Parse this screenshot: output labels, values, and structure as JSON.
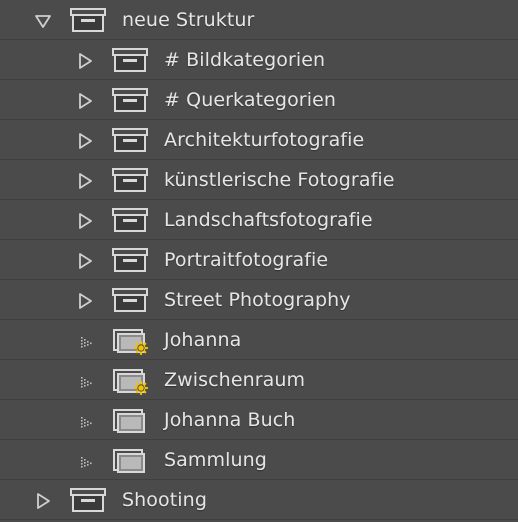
{
  "colors": {
    "background": "#4b4b4b",
    "row_divider": "#3f3f3f",
    "text": "#e6e6e6",
    "icon_stroke": "#d8d8d8",
    "smart_badge": "#f2c200"
  },
  "tree": [
    {
      "label": "neue Struktur",
      "level": 0,
      "expander": "expanded",
      "icon": "collection-set-icon"
    },
    {
      "label": "# Bildkategorien",
      "level": 1,
      "expander": "collapsed",
      "icon": "collection-set-icon"
    },
    {
      "label": "# Querkategorien",
      "level": 1,
      "expander": "collapsed",
      "icon": "collection-set-icon"
    },
    {
      "label": "Architekturfotografie",
      "level": 1,
      "expander": "collapsed",
      "icon": "collection-set-icon"
    },
    {
      "label": "künstlerische Fotografie",
      "level": 1,
      "expander": "collapsed",
      "icon": "collection-set-icon"
    },
    {
      "label": "Landschaftsfotografie",
      "level": 1,
      "expander": "collapsed",
      "icon": "collection-set-icon"
    },
    {
      "label": "Portraitfotografie",
      "level": 1,
      "expander": "collapsed",
      "icon": "collection-set-icon"
    },
    {
      "label": "Street Photography",
      "level": 1,
      "expander": "collapsed",
      "icon": "collection-set-icon"
    },
    {
      "label": "Johanna",
      "level": 1,
      "expander": "none",
      "icon": "smart-collection-icon"
    },
    {
      "label": "Zwischenraum",
      "level": 1,
      "expander": "none",
      "icon": "smart-collection-icon"
    },
    {
      "label": "Johanna Buch",
      "level": 1,
      "expander": "none",
      "icon": "collection-icon"
    },
    {
      "label": "Sammlung",
      "level": 1,
      "expander": "none",
      "icon": "collection-icon"
    },
    {
      "label": "Shooting",
      "level": 0,
      "expander": "collapsed",
      "icon": "collection-set-icon"
    }
  ]
}
